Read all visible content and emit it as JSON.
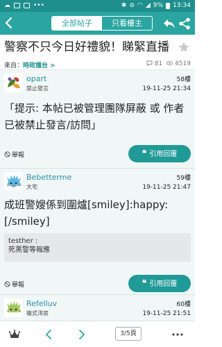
{
  "status_bar": {
    "battery_text": "9%",
    "time": "13:34"
  },
  "nav": {
    "tabs": [
      {
        "label": "全部帖子"
      },
      {
        "label": "只看樓主"
      }
    ]
  },
  "thread": {
    "title": "警察不只今日好禮貌！睇緊直播"
  },
  "meta": {
    "from_label": "來自：",
    "forum": "時政擂台 >",
    "replies": "81",
    "views": "4519"
  },
  "posts": [
    {
      "username": "opart",
      "rank": "禁止發言",
      "floor": "58樓",
      "time": "19-11-25 21:34",
      "content": "「提示: 本帖已被管理團隊屏蔽 或 作者已被禁止發言/訪問」",
      "report_label": "舉報",
      "reply_label": "引用回覆"
    },
    {
      "username": "Bebetterme",
      "rank": "大宅",
      "floor": "59樓",
      "time": "19-11-25 21:47",
      "content": "成班警嫂係到圍爐[smiley]:happy:[/smiley]",
      "quote_author": "testher :",
      "quote_text": "死黑警等報應",
      "report_label": "舉報",
      "reply_label": "引用回覆"
    },
    {
      "username": "Refelluv",
      "rank": "複式洋房",
      "floor": "60樓",
      "time": "19-11-25 21:51"
    }
  ],
  "bottom": {
    "page_indicator": "3/5頁"
  },
  "colors": {
    "primary": "#2aa5a2",
    "status_bar": "#1e8f8c",
    "button": "#1f9a97",
    "post_bg": "#f0f7f6"
  }
}
